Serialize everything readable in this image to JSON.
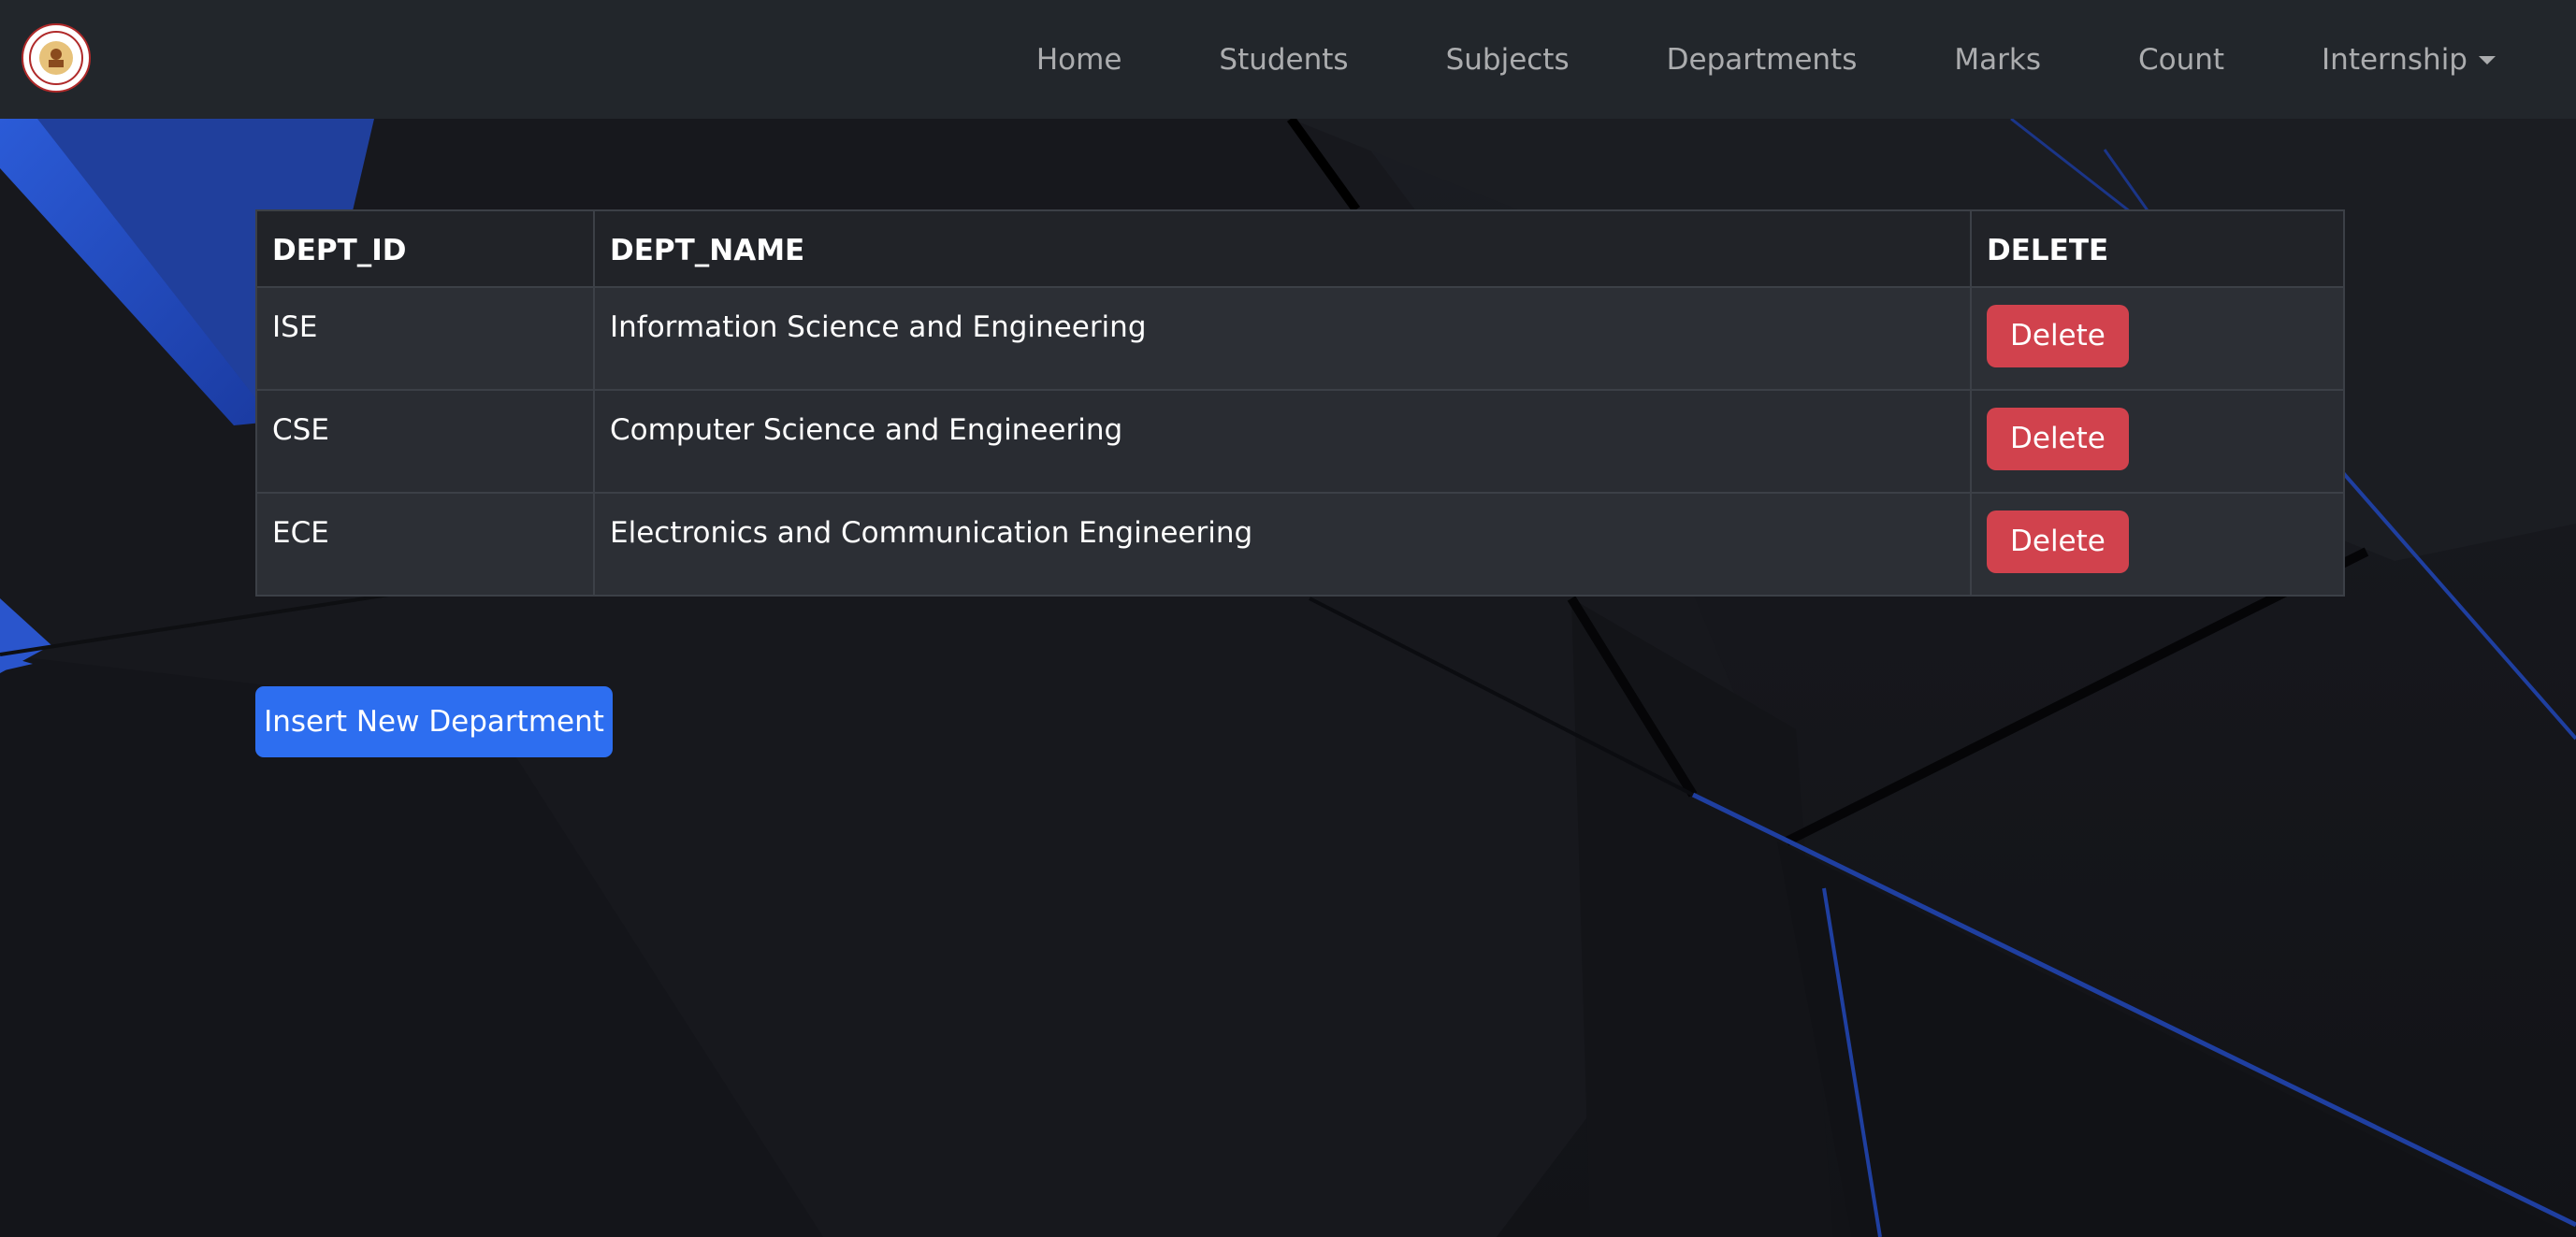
{
  "navbar": {
    "logo": "college-seal-logo",
    "links": [
      {
        "label": "Home"
      },
      {
        "label": "Students"
      },
      {
        "label": "Subjects"
      },
      {
        "label": "Departments"
      },
      {
        "label": "Marks"
      },
      {
        "label": "Count"
      },
      {
        "label": "Internship",
        "has_dropdown": true
      }
    ]
  },
  "table": {
    "headers": [
      "DEPT_ID",
      "DEPT_NAME",
      "DELETE"
    ],
    "rows": [
      {
        "dept_id": "ISE",
        "dept_name": "Information Science and Engineering",
        "action": "Delete"
      },
      {
        "dept_id": "CSE",
        "dept_name": "Computer Science and Engineering",
        "action": "Delete"
      },
      {
        "dept_id": "ECE",
        "dept_name": "Electronics and Communication Engineering",
        "action": "Delete"
      }
    ]
  },
  "actions": {
    "insert_label": "Insert New Department"
  },
  "colors": {
    "navbar_bg": "#22262b",
    "delete_button": "#d1424d",
    "primary_button": "#2d6ef0",
    "accent_blue": "#2b5bd7"
  }
}
